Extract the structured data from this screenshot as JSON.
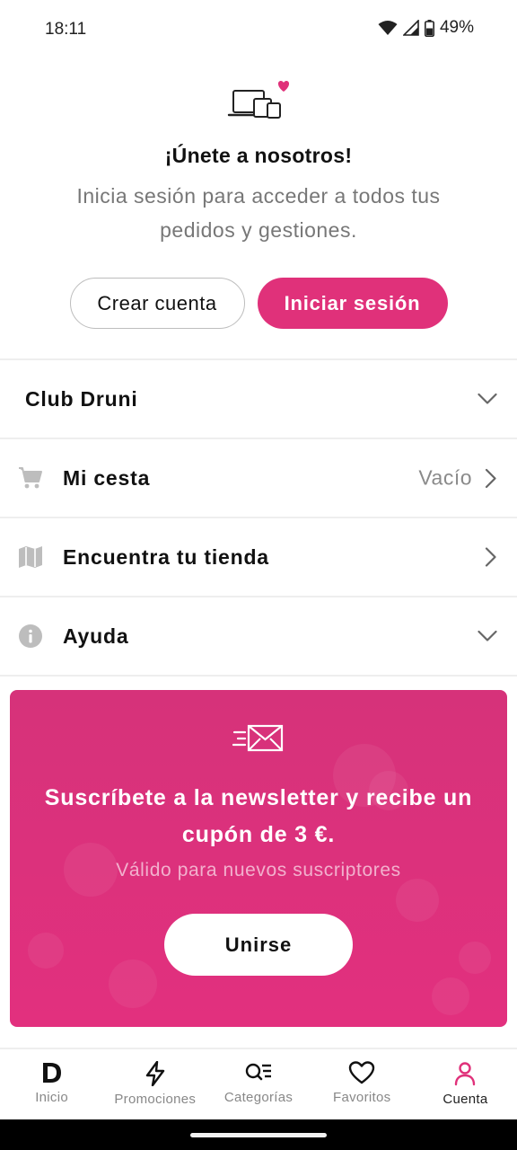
{
  "status_bar": {
    "time": "18:11",
    "battery": "49%"
  },
  "hero": {
    "title": "¡Únete a nosotros!",
    "subtitle": "Inicia sesión para acceder a todos tus pedidos y gestiones.",
    "create_account_label": "Crear cuenta",
    "login_label": "Iniciar sesión"
  },
  "menu": {
    "club": {
      "label": "Club Druni"
    },
    "cart": {
      "label": "Mi cesta",
      "value": "Vacío"
    },
    "store": {
      "label": "Encuentra tu tienda"
    },
    "help": {
      "label": "Ayuda"
    }
  },
  "newsletter": {
    "title": "Suscríbete a la newsletter y recibe un cupón de 3 €.",
    "subtitle": "Válido para nuevos suscriptores",
    "button_label": "Unirse"
  },
  "bottom_nav": {
    "items": [
      {
        "label": "Inicio",
        "icon": "druni-logo-icon"
      },
      {
        "label": "Promociones",
        "icon": "lightning-icon"
      },
      {
        "label": "Categorías",
        "icon": "category-search-icon"
      },
      {
        "label": "Favoritos",
        "icon": "heart-icon"
      },
      {
        "label": "Cuenta",
        "icon": "user-icon"
      }
    ],
    "active_index": 4
  },
  "colors": {
    "accent": "#e0317a",
    "active_nav": "#e0317a",
    "muted_text": "#777777"
  }
}
